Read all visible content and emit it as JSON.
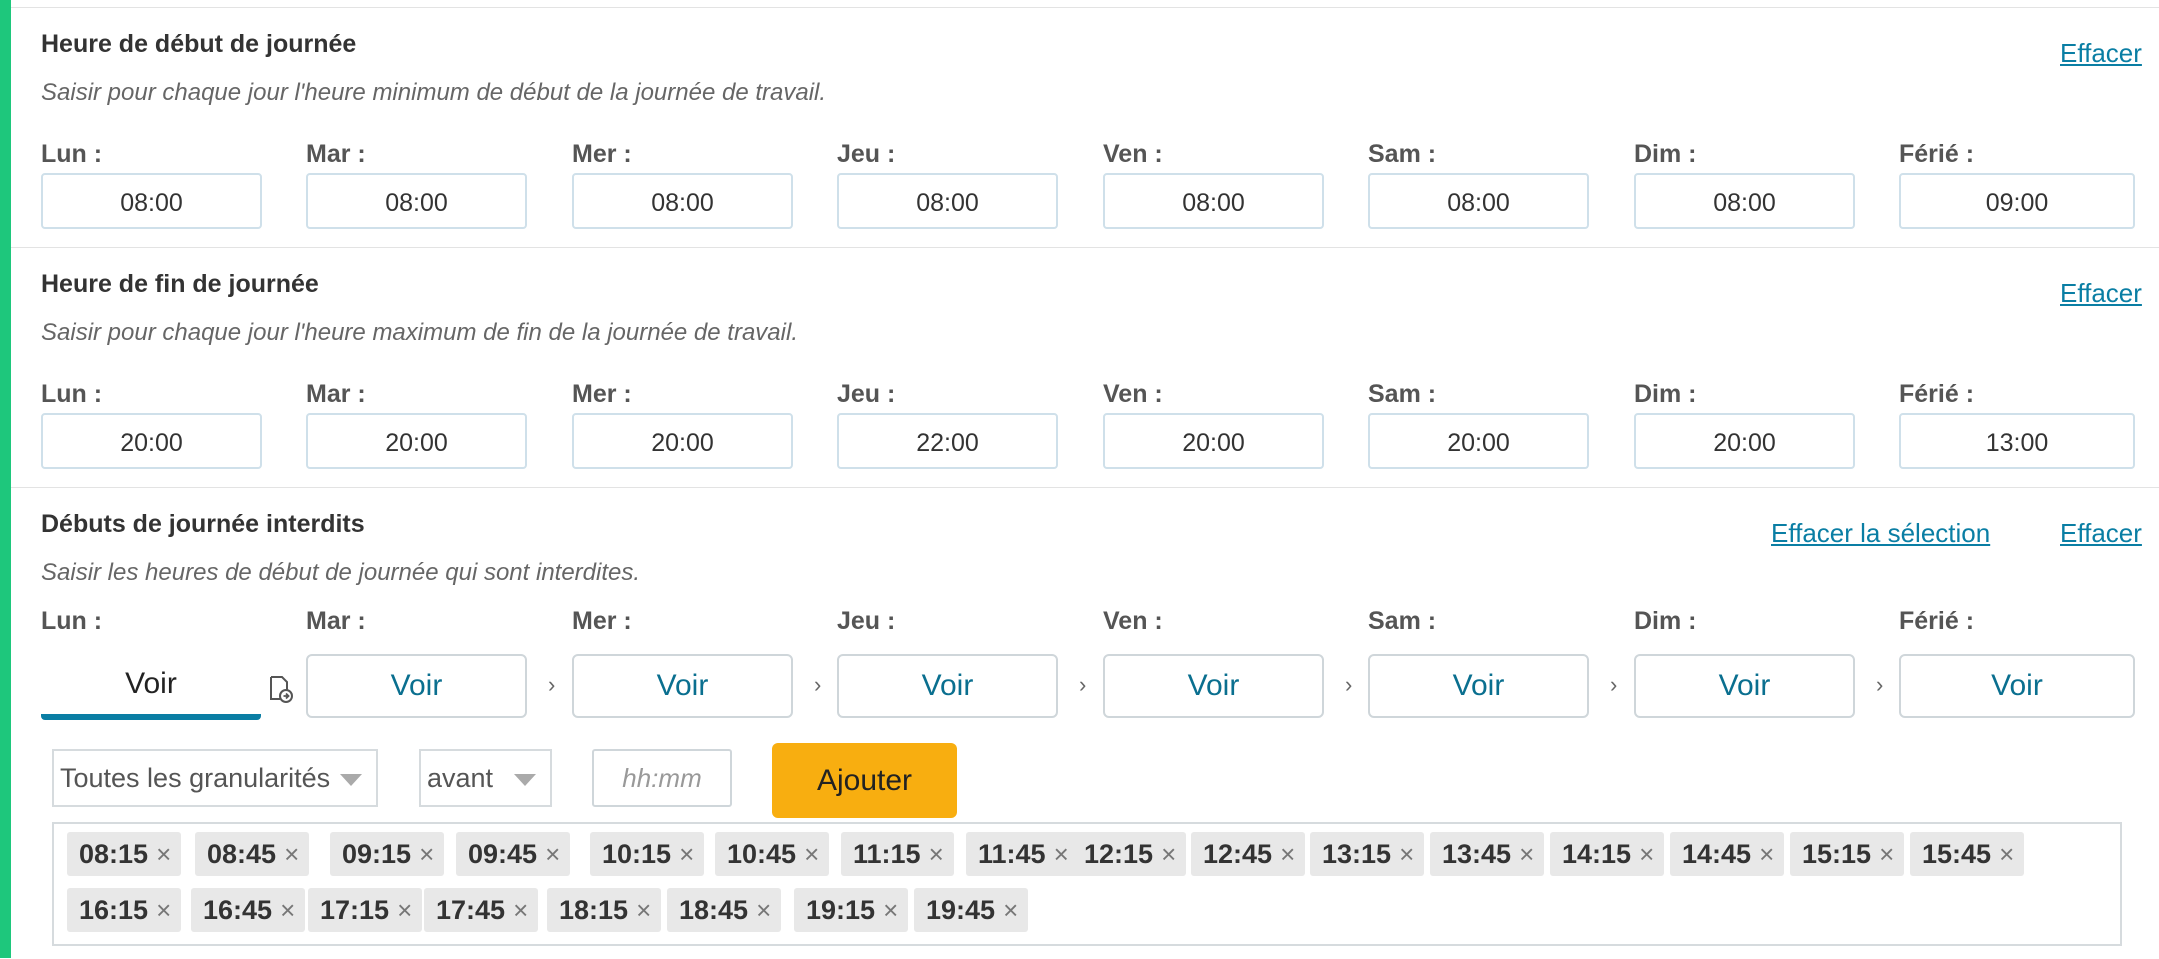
{
  "clear_label": "Effacer",
  "clear_selection_label": "Effacer la sélection",
  "days": [
    "Lun :",
    "Mar :",
    "Mer :",
    "Jeu :",
    "Ven :",
    "Sam :",
    "Dim :",
    "Férié :"
  ],
  "start": {
    "title": "Heure de début de journée",
    "description": "Saisir pour chaque jour l'heure minimum de début de la journée de travail.",
    "times": [
      "08:00",
      "08:00",
      "08:00",
      "08:00",
      "08:00",
      "08:00",
      "08:00",
      "09:00"
    ]
  },
  "end": {
    "title": "Heure de fin de journée",
    "description": "Saisir pour chaque jour l'heure maximum de fin de la journée de travail.",
    "times": [
      "20:00",
      "20:00",
      "20:00",
      "22:00",
      "20:00",
      "20:00",
      "20:00",
      "13:00"
    ]
  },
  "forbidden": {
    "title": "Débuts de journée interdits",
    "description": "Saisir les heures de début de journée qui sont interdites.",
    "voir_label": "Voir",
    "chevron": "›",
    "granularity_select": "Toutes les granularités",
    "position_select": "avant",
    "time_placeholder": "hh:mm",
    "add_label": "Ajouter",
    "remove_glyph": "×",
    "tags": [
      "08:15",
      "08:45",
      "09:15",
      "09:45",
      "10:15",
      "10:45",
      "11:15",
      "11:45",
      "12:15",
      "12:45",
      "13:15",
      "13:45",
      "14:15",
      "14:45",
      "15:15",
      "15:45",
      "16:15",
      "16:45",
      "17:15",
      "17:45",
      "18:15",
      "18:45",
      "19:15",
      "19:45"
    ]
  },
  "colors": {
    "accent": "#1ec77c",
    "link": "#0a7ea4",
    "add_button": "#f8ae10"
  },
  "icons": {
    "copy": "copy-to-all-icon"
  }
}
